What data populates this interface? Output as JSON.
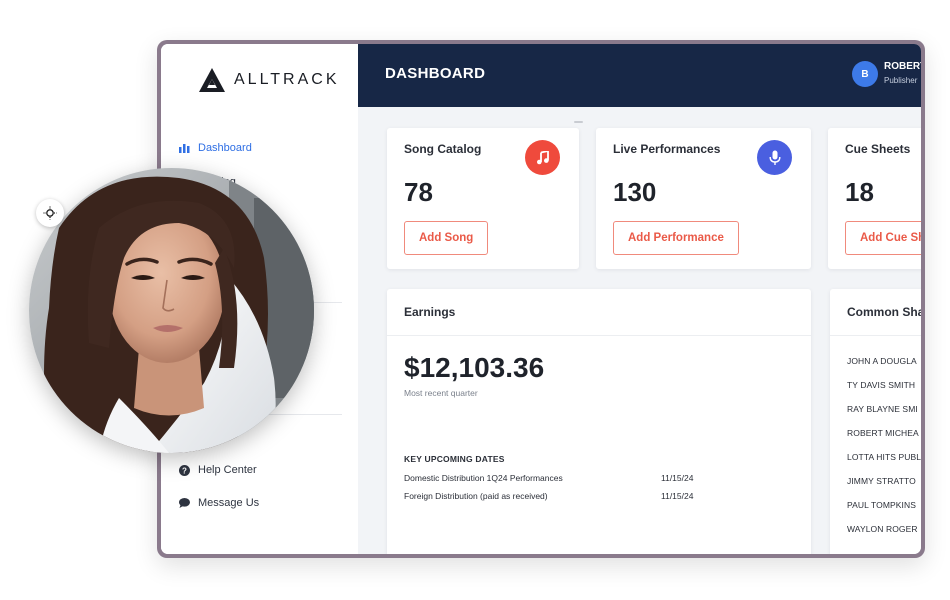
{
  "brand": {
    "name": "ALLTRACK"
  },
  "sidebar": {
    "items": [
      {
        "label": "Dashboard",
        "icon": "bar-chart-icon",
        "active": true
      },
      {
        "label": "Catalog",
        "icon": "catalog-icon",
        "active": false
      },
      {
        "label": "Help Center",
        "icon": "question-icon",
        "active": false
      },
      {
        "label": "Message Us",
        "icon": "chat-bubble-icon",
        "active": false
      }
    ]
  },
  "header": {
    "title": "DASHBOARD",
    "user": {
      "initial": "B",
      "name": "ROBERT",
      "role": "Publisher"
    }
  },
  "stats": [
    {
      "title": "Song Catalog",
      "value": "78",
      "button": "Add Song",
      "icon": "music-note-icon",
      "icon_color": "#ef4a3c"
    },
    {
      "title": "Live Performances",
      "value": "130",
      "button": "Add Performance",
      "icon": "microphone-icon",
      "icon_color": "#4a5fe0"
    },
    {
      "title": "Cue Sheets",
      "value": "18",
      "button": "Add Cue Sh"
    }
  ],
  "earnings": {
    "title": "Earnings",
    "amount": "$12,103.36",
    "subtitle": "Most recent quarter",
    "dates_heading": "KEY UPCOMING DATES",
    "dates": [
      {
        "label": "Domestic Distribution 1Q24 Performances",
        "date": "11/15/24"
      },
      {
        "label": "Foreign Distribution (paid as received)",
        "date": "11/15/24"
      }
    ]
  },
  "shares": {
    "title": "Common Sha",
    "rows": [
      "JOHN A DOUGLA",
      "TY DAVIS SMITH",
      "RAY BLAYNE SMI",
      "ROBERT MICHEA",
      "LOTTA HITS PUBL",
      "JIMMY STRATTO",
      "PAUL TOMPKINS",
      "WAYLON ROGER"
    ]
  },
  "colors": {
    "topbar": "#172746",
    "accent_blue": "#2f6fe4",
    "button_red": "#ea5a48"
  }
}
